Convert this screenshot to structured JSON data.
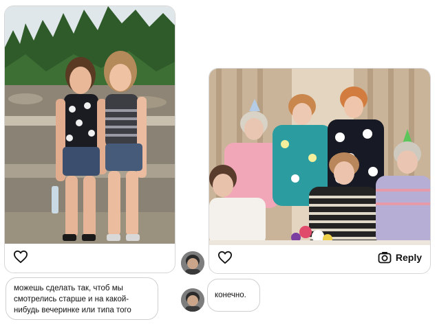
{
  "left_post": {
    "like_icon": "heart-outline-icon"
  },
  "right_post": {
    "like_icon": "heart-outline-icon",
    "reply_icon": "camera-icon",
    "reply_label": "Reply"
  },
  "messages": [
    {
      "text": "можешь сделать так, чтоб мы смотрелись старше и на какой-нибудь вечеринке или типа того"
    },
    {
      "text": "конечно."
    }
  ],
  "colors": {
    "border": "#d6d6d6",
    "bubble_border": "#cfcfcf",
    "text": "#111111"
  }
}
